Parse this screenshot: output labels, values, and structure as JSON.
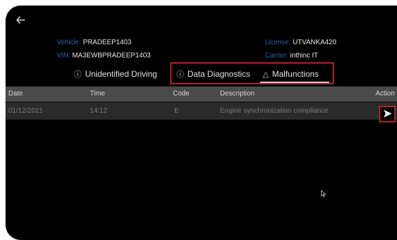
{
  "vehicle": {
    "label": "Vehicle:",
    "value": "PRADEEP1403"
  },
  "vin": {
    "label": "VIN:",
    "value": "MA3EWBPRADEEP1403"
  },
  "license": {
    "label": "License:",
    "value": "UTVANKA420"
  },
  "carrier": {
    "label": "Carrier:",
    "value": "inthinc IT"
  },
  "tabs": [
    {
      "label": "Unidentified Driving",
      "icon": "info-circle-icon"
    },
    {
      "label": "Data Diagnostics",
      "icon": "info-circle-icon"
    },
    {
      "label": "Malfunctions",
      "icon": "warning-triangle-icon"
    }
  ],
  "table": {
    "columns": [
      "Date",
      "Time",
      "Code",
      "Description",
      "Action"
    ],
    "rows": [
      {
        "date": "01/12/2021",
        "time": "14:12",
        "code": "E",
        "description": "Engine synchronization compliance"
      }
    ]
  },
  "colors": {
    "highlight": "#b51f31",
    "label_blue": "#2c62a0",
    "header_bg": "#4a4a4a",
    "row_bg": "#2a2a2a"
  }
}
